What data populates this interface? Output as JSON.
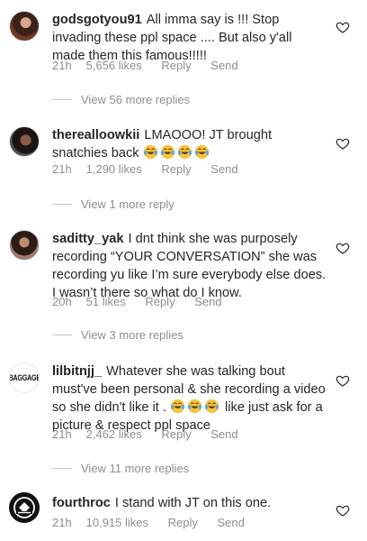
{
  "comments": [
    {
      "username": "godsgotyou91",
      "text": "All imma say is !!! Stop invading these ppl space .... But also y'all made them this famous!!!!!",
      "time": "21h",
      "likes": "5,656 likes",
      "reply": "Reply",
      "send": "Send",
      "view_replies": "View 56 more replies",
      "avatar_icon": "profile-photo"
    },
    {
      "username": "therealloowkii",
      "text": "LMAOOO! JT brought snatchies back",
      "emoji_count": 4,
      "emoji_icon": "face-with-tears-of-joy",
      "time": "21h",
      "likes": "1,290 likes",
      "reply": "Reply",
      "send": "Send",
      "view_replies": "View 1 more reply",
      "avatar_icon": "profile-photo"
    },
    {
      "username": "saditty_yak",
      "text": "I dnt think she was purposely recording “YOUR CONVERSATION” she was recording yu like I’m sure everybody else does. I wasn’t there so what do I know.",
      "time": "20h",
      "likes": "51 likes",
      "reply": "Reply",
      "send": "Send",
      "view_replies": "View 3 more replies",
      "avatar_icon": "profile-photo"
    },
    {
      "username": "lilbitnjj_",
      "text_before": "Whatever she was talking bout must've been personal & she recording a video so she didn't like it .",
      "emoji_count": 3,
      "emoji_icon": "face-with-tears-of-joy",
      "text_after": "like just ask for a picture & respect ppl space",
      "time": "21h",
      "likes": "2,462 likes",
      "reply": "Reply",
      "send": "Send",
      "view_replies": "View 11 more replies",
      "avatar_text": "BAGGAGE",
      "avatar_icon": "brand-logo"
    },
    {
      "username": "fourthroc",
      "text": "I stand with JT on this one.",
      "time": "21h",
      "likes": "10,915 likes",
      "reply": "Reply",
      "send": "Send",
      "avatar_icon": "brand-logo"
    }
  ],
  "colors": {
    "text": "#262626",
    "meta": "#8e8e8e",
    "background": "#ffffff"
  }
}
